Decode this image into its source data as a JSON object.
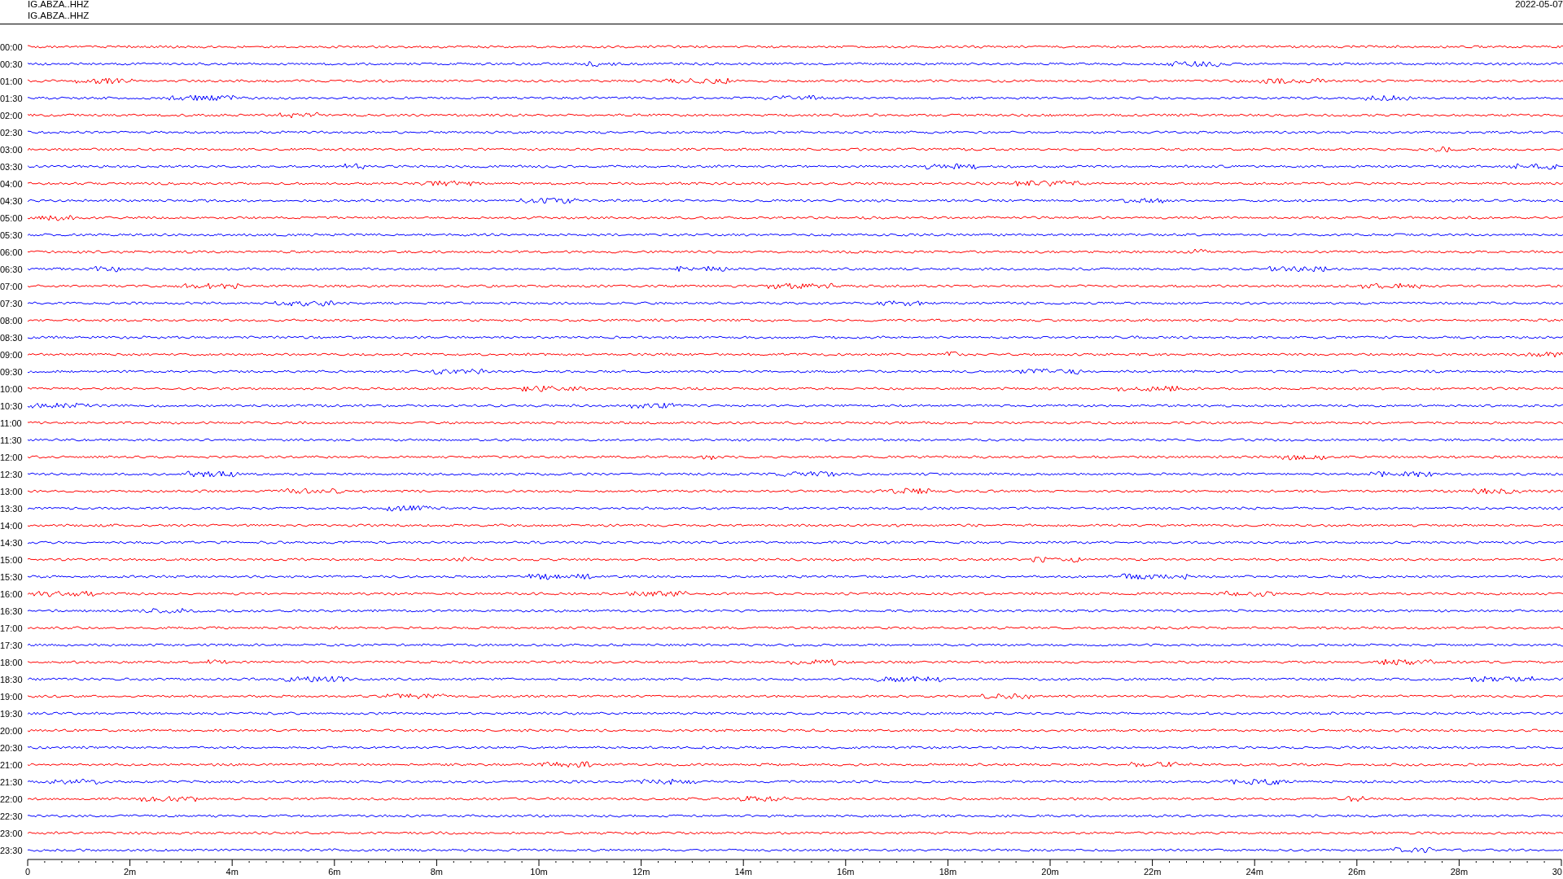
{
  "header": {
    "station_lines": [
      "IG.ABZA..HHZ",
      "IG.ABZA..HHZ"
    ],
    "date": "2022-05-07"
  },
  "traces": [
    {
      "time": "00:00",
      "color": "#ff0000"
    },
    {
      "time": "00:30",
      "color": "#0000ff"
    },
    {
      "time": "01:00",
      "color": "#ff0000"
    },
    {
      "time": "01:30",
      "color": "#0000ff"
    },
    {
      "time": "02:00",
      "color": "#ff0000"
    },
    {
      "time": "02:30",
      "color": "#0000ff"
    },
    {
      "time": "03:00",
      "color": "#ff0000"
    },
    {
      "time": "03:30",
      "color": "#0000ff"
    },
    {
      "time": "04:00",
      "color": "#ff0000"
    },
    {
      "time": "04:30",
      "color": "#0000ff"
    },
    {
      "time": "05:00",
      "color": "#ff0000"
    },
    {
      "time": "05:30",
      "color": "#0000ff"
    },
    {
      "time": "06:00",
      "color": "#ff0000"
    },
    {
      "time": "06:30",
      "color": "#0000ff"
    },
    {
      "time": "07:00",
      "color": "#ff0000"
    },
    {
      "time": "07:30",
      "color": "#0000ff"
    },
    {
      "time": "08:00",
      "color": "#ff0000"
    },
    {
      "time": "08:30",
      "color": "#0000ff"
    },
    {
      "time": "09:00",
      "color": "#ff0000"
    },
    {
      "time": "09:30",
      "color": "#0000ff"
    },
    {
      "time": "10:00",
      "color": "#ff0000"
    },
    {
      "time": "10:30",
      "color": "#0000ff"
    },
    {
      "time": "11:00",
      "color": "#ff0000"
    },
    {
      "time": "11:30",
      "color": "#0000ff"
    },
    {
      "time": "12:00",
      "color": "#ff0000"
    },
    {
      "time": "12:30",
      "color": "#0000ff"
    },
    {
      "time": "13:00",
      "color": "#ff0000"
    },
    {
      "time": "13:30",
      "color": "#0000ff"
    },
    {
      "time": "14:00",
      "color": "#ff0000"
    },
    {
      "time": "14:30",
      "color": "#0000ff"
    },
    {
      "time": "15:00",
      "color": "#ff0000"
    },
    {
      "time": "15:30",
      "color": "#0000ff"
    },
    {
      "time": "16:00",
      "color": "#ff0000"
    },
    {
      "time": "16:30",
      "color": "#0000ff"
    },
    {
      "time": "17:00",
      "color": "#ff0000"
    },
    {
      "time": "17:30",
      "color": "#0000ff"
    },
    {
      "time": "18:00",
      "color": "#ff0000"
    },
    {
      "time": "18:30",
      "color": "#0000ff"
    },
    {
      "time": "19:00",
      "color": "#ff0000"
    },
    {
      "time": "19:30",
      "color": "#0000ff"
    },
    {
      "time": "20:00",
      "color": "#ff0000"
    },
    {
      "time": "20:30",
      "color": "#0000ff"
    },
    {
      "time": "21:00",
      "color": "#ff0000"
    },
    {
      "time": "21:30",
      "color": "#0000ff"
    },
    {
      "time": "22:00",
      "color": "#ff0000"
    },
    {
      "time": "22:30",
      "color": "#0000ff"
    },
    {
      "time": "23:00",
      "color": "#ff0000"
    },
    {
      "time": "23:30",
      "color": "#0000ff"
    }
  ],
  "x_axis": {
    "labels": [
      "0",
      "2m",
      "4m",
      "6m",
      "8m",
      "10m",
      "12m",
      "14m",
      "16m",
      "18m",
      "20m",
      "22m",
      "24m",
      "26m",
      "28m",
      "30"
    ]
  }
}
